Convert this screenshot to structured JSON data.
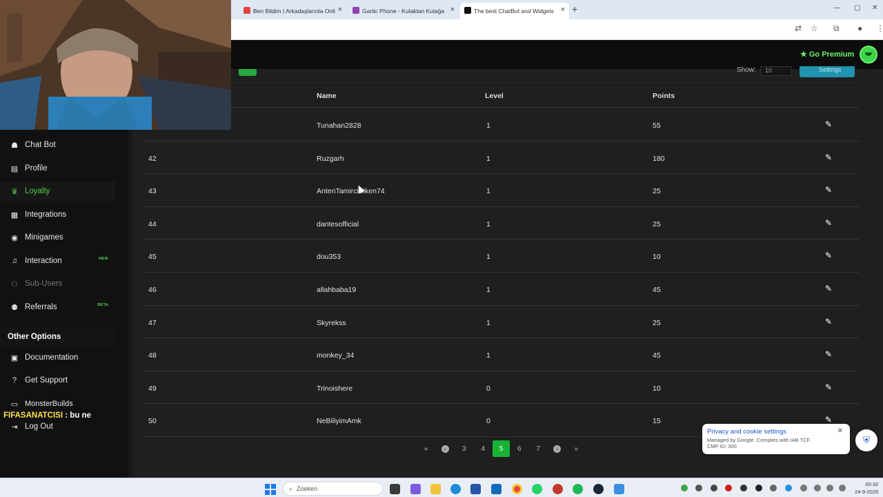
{
  "browser": {
    "tabs": [
      {
        "title": "Ben Bildim | Arkadaşlarınla Onli",
        "favicon_color": "#e3433c"
      },
      {
        "title": "Gartic Phone - Kulaktan Kulağa",
        "favicon_color": "#8e44ad"
      },
      {
        "title": "The best ChatBot and Widgets",
        "favicon_color": "#111111"
      }
    ],
    "new_tab": "+"
  },
  "header": {
    "premium_label": "Go Premium",
    "premium_color": "#6cf36a"
  },
  "sidebar": {
    "items": [
      {
        "label": "Chat Bot",
        "icon": "robot-icon"
      },
      {
        "label": "Profile",
        "icon": "id-card-icon"
      },
      {
        "label": "Loyalty",
        "icon": "trophy-icon",
        "active": true
      },
      {
        "label": "Integrations",
        "icon": "puzzle-icon"
      },
      {
        "label": "Minigames",
        "icon": "gamepad-icon"
      },
      {
        "label": "Interaction",
        "icon": "music-note-icon",
        "badge": "NEW"
      },
      {
        "label": "Sub-Users",
        "icon": "users-icon",
        "muted": true
      },
      {
        "label": "Referrals",
        "icon": "user-plus-icon",
        "badge": "BETA"
      }
    ],
    "other_section": "Other Options",
    "other_items": [
      {
        "label": "Documentation",
        "icon": "document-icon"
      },
      {
        "label": "Get Support",
        "icon": "question-circle-icon"
      },
      {
        "label": "MonsterBuilds",
        "icon": "laptop-icon"
      },
      {
        "label": "Log Out",
        "icon": "logout-icon"
      }
    ],
    "accent_color": "#4fd24a"
  },
  "chat_overlay": {
    "user": "FIFASANATCISI",
    "separator": ":",
    "message": "bu ne"
  },
  "controls": {
    "show_label": "Show:",
    "show_value": "10",
    "settings_label": "Settings"
  },
  "table": {
    "columns": [
      "Name",
      "Level",
      "Points"
    ],
    "rows": [
      {
        "id": "",
        "name": "Tunahan2828",
        "level": "1",
        "points": "55"
      },
      {
        "id": "42",
        "name": "Ruzgarh",
        "level": "1",
        "points": "180"
      },
      {
        "id": "43",
        "name": "AntenTamirciSiken74",
        "level": "1",
        "points": "25"
      },
      {
        "id": "44",
        "name": "dantesofficial",
        "level": "1",
        "points": "25"
      },
      {
        "id": "45",
        "name": "dou353",
        "level": "1",
        "points": "10"
      },
      {
        "id": "46",
        "name": "allahbaba19",
        "level": "1",
        "points": "45"
      },
      {
        "id": "47",
        "name": "Skyrekss",
        "level": "1",
        "points": "25"
      },
      {
        "id": "48",
        "name": "monkey_34",
        "level": "1",
        "points": "45"
      },
      {
        "id": "49",
        "name": "Trinoishere",
        "level": "0",
        "points": "10"
      },
      {
        "id": "50",
        "name": "NeBiliyimAmk",
        "level": "0",
        "points": "15"
      }
    ]
  },
  "pagination": {
    "first": "«",
    "prev": "‹",
    "pages": [
      "3",
      "4",
      "5",
      "6",
      "7"
    ],
    "current": "5",
    "next": "›",
    "last": "»"
  },
  "cookie": {
    "title": "Privacy and cookie settings",
    "line1": "Managed by Google. Complies with IAB TCF.",
    "line2": "CMP ID: 300"
  },
  "taskbar": {
    "search_placeholder": "Zoeken",
    "time": "00:32",
    "date": "24-9-2025"
  }
}
